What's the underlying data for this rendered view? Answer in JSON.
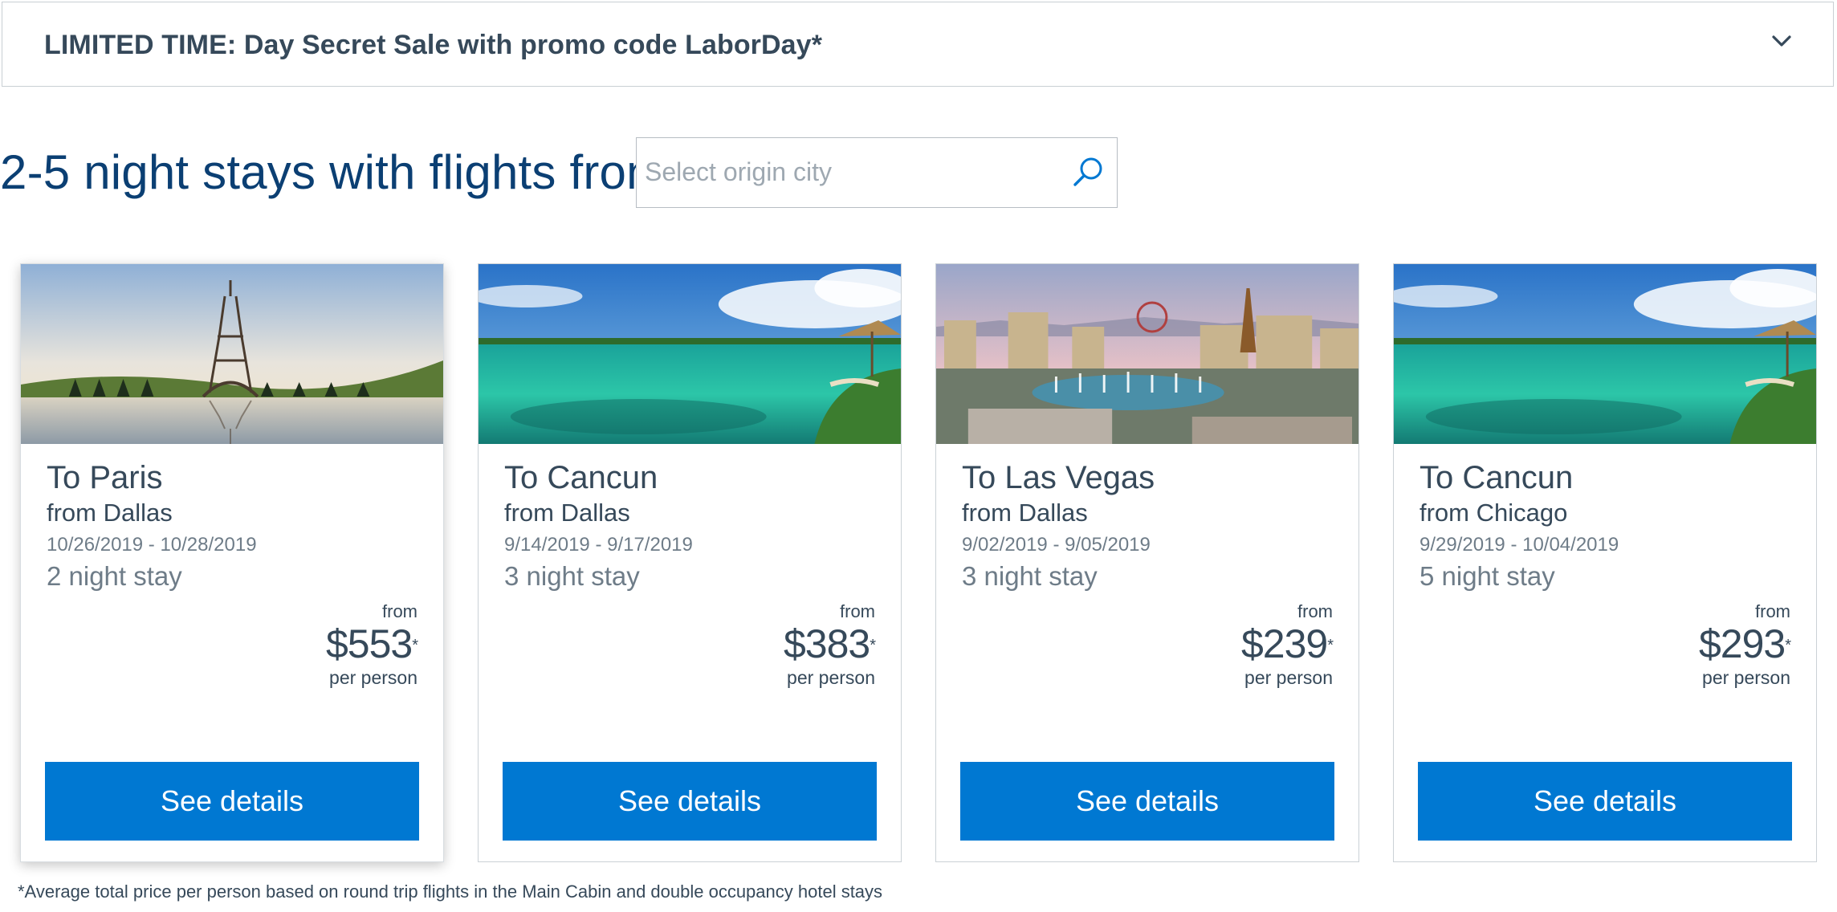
{
  "promo": {
    "text": "LIMITED TIME: Day Secret Sale with promo code LaborDay*",
    "icon": "chevron-down-icon"
  },
  "headline": "2-5 night stays with flights from",
  "search": {
    "placeholder": "Select origin city",
    "value": "",
    "icon": "search-icon"
  },
  "cards": [
    {
      "destination": "To Paris",
      "origin": "from Dallas",
      "dates": "10/26/2019 - 10/28/2019",
      "stay": "2 night stay",
      "from_label": "from",
      "price": "$553",
      "asterisk": "*",
      "per": "per person",
      "button": "See details",
      "image": "eiffel-tower-reflection"
    },
    {
      "destination": "To Cancun",
      "origin": "from Dallas",
      "dates": "9/14/2019 - 9/17/2019",
      "stay": "3 night stay",
      "from_label": "from",
      "price": "$383",
      "asterisk": "*",
      "per": "per person",
      "button": "See details",
      "image": "cancun-lagoon"
    },
    {
      "destination": "To Las Vegas",
      "origin": "from Dallas",
      "dates": "9/02/2019 - 9/05/2019",
      "stay": "3 night stay",
      "from_label": "from",
      "price": "$239",
      "asterisk": "*",
      "per": "per person",
      "button": "See details",
      "image": "las-vegas-strip"
    },
    {
      "destination": "To Cancun",
      "origin": "from Chicago",
      "dates": "9/29/2019 - 10/04/2019",
      "stay": "5 night stay",
      "from_label": "from",
      "price": "$293",
      "asterisk": "*",
      "per": "per person",
      "button": "See details",
      "image": "cancun-lagoon"
    }
  ],
  "footnote": "*Average total price per person based on round trip flights in the Main Cabin and double occupancy hotel stays",
  "colors": {
    "brand_blue": "#0078d2",
    "headline_blue": "#0b3f73",
    "text": "#36495a",
    "muted": "#6e7c88"
  }
}
